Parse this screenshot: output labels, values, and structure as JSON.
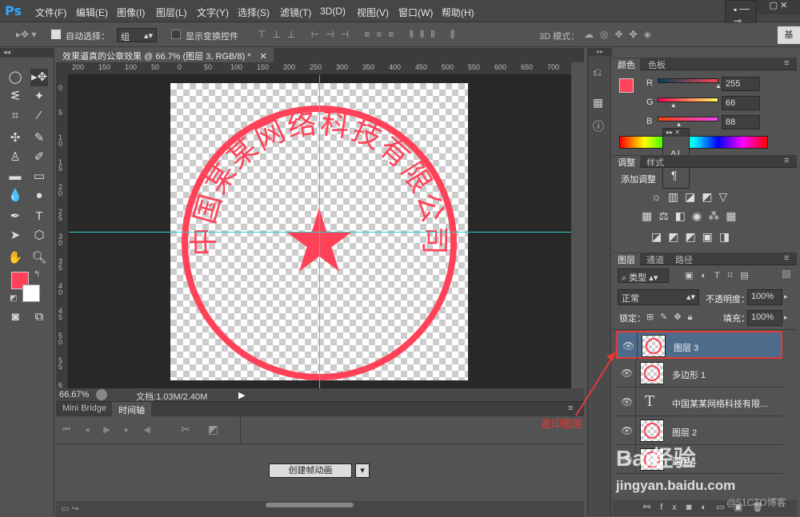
{
  "app": {
    "logo": "Ps"
  },
  "menu": [
    "文件(F)",
    "编辑(E)",
    "图像(I)",
    "图层(L)",
    "文字(Y)",
    "选择(S)",
    "滤镜(T)",
    "3D(D)",
    "视图(V)",
    "窗口(W)",
    "帮助(H)"
  ],
  "options": {
    "auto_select_label": "自动选择：",
    "auto_select_value": "组",
    "show_transform_label": "显示变换控件",
    "mode_3d_label": "3D 模式：",
    "workspace_label": "基"
  },
  "document": {
    "tab_title": "效果逼真的公章效果 @ 66.7% (图层 3, RGB/8) *",
    "ruler_h": [
      "200",
      "150",
      "100",
      "50",
      "0",
      "50",
      "100",
      "150",
      "200",
      "250",
      "300",
      "350",
      "400",
      "450",
      "500",
      "550",
      "600",
      "650",
      "700"
    ],
    "ruler_v": [
      "0",
      "5",
      "1 0",
      "1 5",
      "2 0",
      "2 5",
      "3 0",
      "3 5",
      "4 0",
      "4 5",
      "5 0",
      "5 5",
      "6"
    ],
    "stamp_text": "中国某某网络科技有限公司",
    "zoom": "66.67%",
    "doc_size": "文档:1.03M/2.40M"
  },
  "timeline": {
    "tabs": [
      "Mini Bridge",
      "时间轴"
    ],
    "create_button": "创建帧动画"
  },
  "color_panel": {
    "tabs": [
      "颜色",
      "色板"
    ],
    "channels": [
      {
        "label": "R",
        "value": "255",
        "level": 1.0
      },
      {
        "label": "G",
        "value": "66",
        "level": 0.26
      },
      {
        "label": "B",
        "value": "88",
        "level": 0.35
      }
    ]
  },
  "adjust_panel": {
    "tabs": [
      "调整",
      "样式"
    ],
    "add_label": "添加调整"
  },
  "layers_panel": {
    "tabs": [
      "图层",
      "通道",
      "路径"
    ],
    "filter_label": "类型",
    "blend_mode": "正常",
    "opacity_label": "不透明度：",
    "opacity_value": "100%",
    "lock_label": "锁定：",
    "fill_label": "填充：",
    "fill_value": "100%",
    "layers": [
      {
        "name": "图层 3",
        "selected": true
      },
      {
        "name": "多边形 1",
        "selected": false
      },
      {
        "name": "中国某某网络科技有限...",
        "selected": false,
        "type": "text"
      },
      {
        "name": "图层 2",
        "selected": false
      },
      {
        "name": "图层 1",
        "selected": false
      }
    ]
  },
  "annotation": {
    "text": "盖印图层",
    "color": "#e53935"
  },
  "watermark": {
    "brand": "Bai经验",
    "url": "jingyan.baidu.com",
    "credit": "@51CTO博客"
  },
  "colors": {
    "stamp": "#ff4258",
    "guide": "#33cccc",
    "selection": "#4f6b8c"
  }
}
